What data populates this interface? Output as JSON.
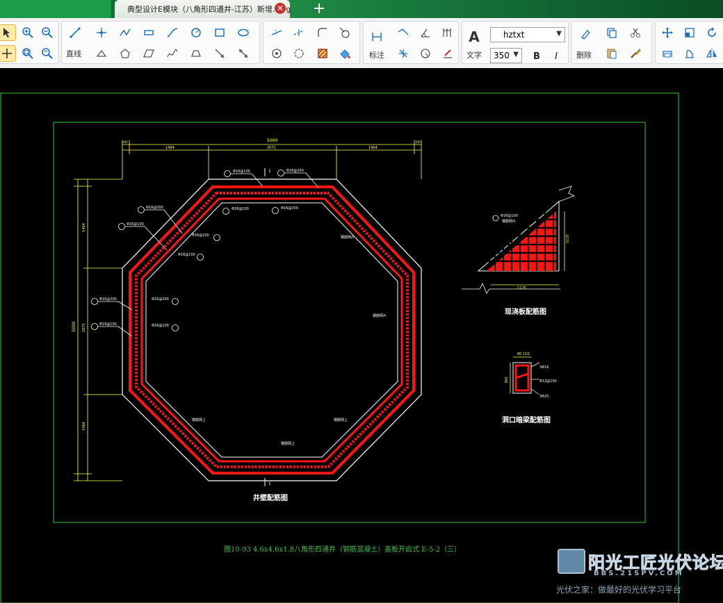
{
  "titlebar": {
    "tab_title": "典型设计E模块（八角形四通井-江苏）新增.dwg",
    "close_glyph": "✕",
    "new_tab_glyph": "+"
  },
  "toolbar": {
    "line_label": "直线",
    "dimension_label": "标注",
    "text_label": "文字",
    "delete_label": "删除",
    "font_select_value": "hztxt",
    "font_size_value": "350",
    "bold_label": "B",
    "italic_label": "I"
  },
  "drawing": {
    "main_title": "图10-93 4.6x4.6x1.8八角形四通井（钢筋混凝土）盖板开启式   E-5-2（三）",
    "octagon_caption": "井壁配筋图",
    "slab_caption": "现浇板配筋图",
    "beam_caption": "洞口暗梁配筋图",
    "dim_total": "5000",
    "dim_left": "1464",
    "dim_mid": "2071",
    "dim_right": "1464",
    "dim_edge": "100",
    "vert_total": "5000",
    "rebar_a": "Φ16@200",
    "rebar_b": "Φ16@100",
    "rebar_c": "Φ16@200",
    "rebar_d": "Φ16@100",
    "section_mark": "1",
    "note_upper": "钢筋网片",
    "note_lower": "钢筋网上",
    "slab_dim": "1125",
    "slab_note": "Φ16@100",
    "slab_note2": "钢筋网片",
    "beam_dims": [
      "80",
      "110",
      "360",
      "300"
    ],
    "beam_notes": [
      "3Φ16",
      "Φ12@100",
      "3Φ25"
    ]
  },
  "watermark": {
    "brand": "阳光工匠光伏论坛",
    "site": "BBS.21SPV.COM",
    "slogan": "光伏之家：做最好的光伏学习平台"
  },
  "colors": {
    "cad_background": "#000000",
    "frame": "#2bd12b",
    "white_lines": "#ffffff",
    "rebar_red": "#ff1414",
    "dimension_yellow": "#ffff55",
    "title_green": "#3fc24a"
  }
}
